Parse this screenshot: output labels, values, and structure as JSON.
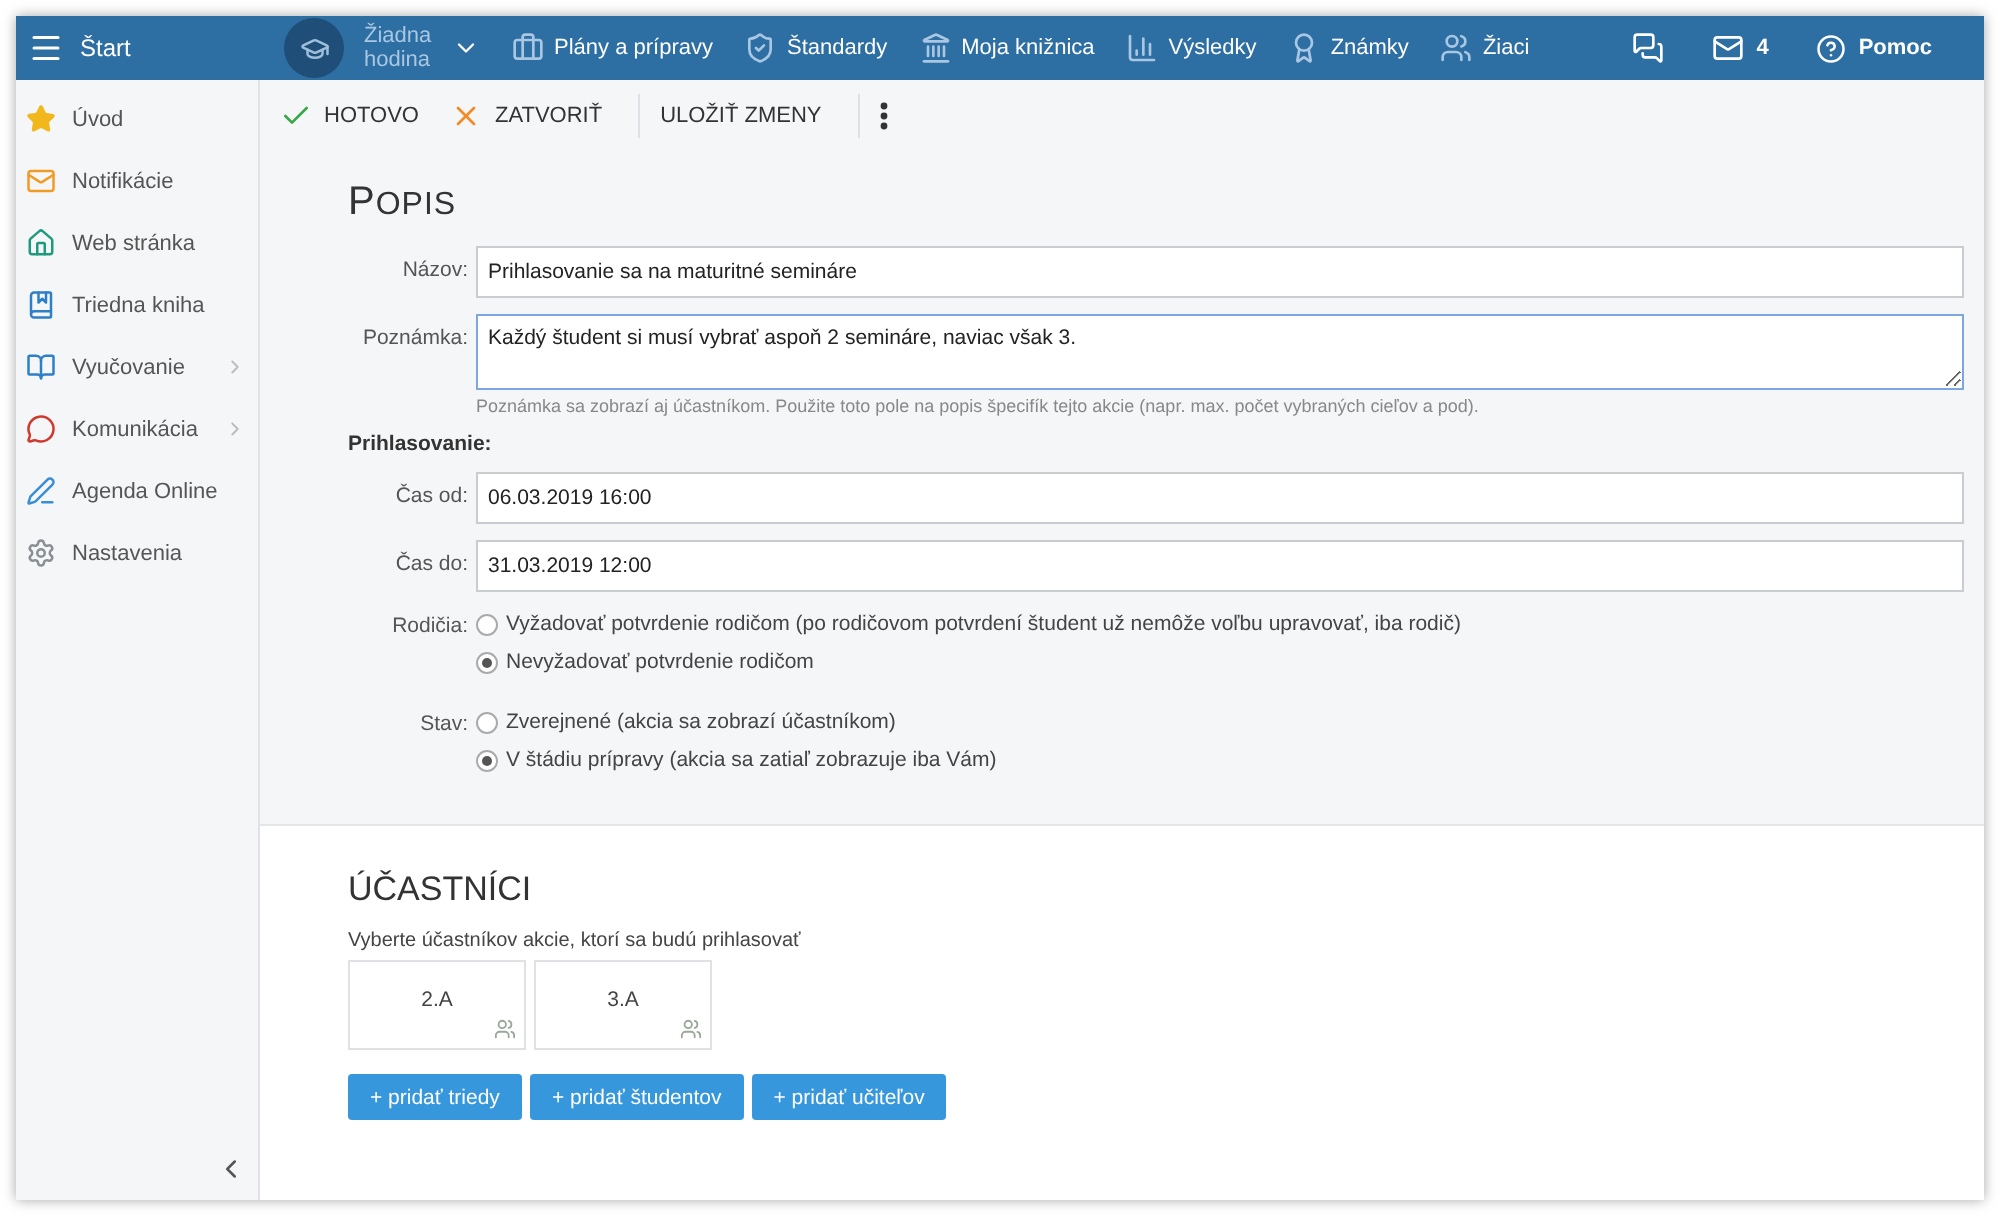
{
  "topbar": {
    "menu_label": "Štart",
    "lesson": "Žiadna hodina",
    "nav": [
      {
        "label": "Plány a prípravy"
      },
      {
        "label": "Štandardy"
      },
      {
        "label": "Moja knižnica"
      },
      {
        "label": "Výsledky"
      },
      {
        "label": "Známky"
      },
      {
        "label": "Žiaci"
      }
    ],
    "messages_count": "4",
    "help": "Pomoc"
  },
  "sidebar": {
    "items": [
      {
        "label": "Úvod",
        "has_submenu": false
      },
      {
        "label": "Notifikácie",
        "has_submenu": false
      },
      {
        "label": "Web stránka",
        "has_submenu": false
      },
      {
        "label": "Triedna kniha",
        "has_submenu": false
      },
      {
        "label": "Vyučovanie",
        "has_submenu": true
      },
      {
        "label": "Komunikácia",
        "has_submenu": true
      },
      {
        "label": "Agenda Online",
        "has_submenu": false
      },
      {
        "label": "Nastavenia",
        "has_submenu": false
      }
    ]
  },
  "toolbar": {
    "done": "HOTOVO",
    "close": "ZATVORIŤ",
    "save": "ULOŽIŤ ZMENY"
  },
  "description": {
    "title": "POPIS",
    "name_label": "Názov:",
    "name_value": "Prihlasovanie sa na maturitné semináre",
    "note_label": "Poznámka:",
    "note_value": "Každý študent si musí vybrať aspoň 2 semináre, naviac však 3.",
    "note_hint": "Poznámka sa zobrazí aj účastníkom. Použite toto pole na popis špecifík tejto akcie (napr. max. počet vybraných cieľov a pod).",
    "signup_heading": "Prihlasovanie:",
    "from_label": "Čas od:",
    "from_value": "06.03.2019 16:00",
    "to_label": "Čas do:",
    "to_value": "31.03.2019 12:00",
    "parents_label": "Rodičia:",
    "parents_options": [
      {
        "label": "Vyžadovať potvrdenie rodičom (po rodičovom potvrdení študent už nemôže voľbu upravovať, iba rodič)",
        "selected": false
      },
      {
        "label": "Nevyžadovať potvrdenie rodičom",
        "selected": true
      }
    ],
    "state_label": "Stav:",
    "state_options": [
      {
        "label": "Zverejnené (akcia sa zobrazí účastníkom)",
        "selected": false
      },
      {
        "label": "V štádiu prípravy (akcia sa zatiaľ zobrazuje iba Vám)",
        "selected": true
      }
    ]
  },
  "participants": {
    "title": "ÚČASTNÍCI",
    "hint": "Vyberte účastníkov akcie, ktorí sa budú prihlasovať",
    "groups": [
      {
        "label": "2.A"
      },
      {
        "label": "3.A"
      }
    ],
    "buttons": [
      "+ pridať triedy",
      "+ pridať študentov",
      "+ pridať učiteľov"
    ]
  }
}
